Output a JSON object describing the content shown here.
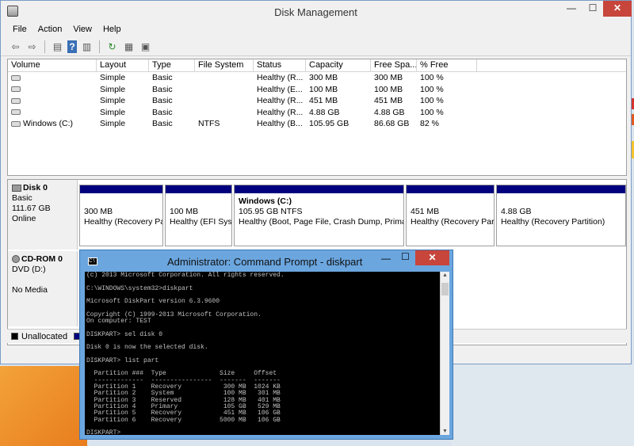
{
  "window": {
    "title": "Disk Management"
  },
  "menu": [
    "File",
    "Action",
    "View",
    "Help"
  ],
  "toolbar_icons": [
    "back-icon",
    "forward-icon",
    "properties-icon",
    "help-icon",
    "console-tree-icon",
    "refresh-icon",
    "rescan-icon",
    "settings-icon"
  ],
  "volumes": {
    "headers": [
      "Volume",
      "Layout",
      "Type",
      "File System",
      "Status",
      "Capacity",
      "Free Spa...",
      "% Free"
    ],
    "rows": [
      [
        "",
        "Simple",
        "Basic",
        "",
        "Healthy (R...",
        "300 MB",
        "300 MB",
        "100 %"
      ],
      [
        "",
        "Simple",
        "Basic",
        "",
        "Healthy (E...",
        "100 MB",
        "100 MB",
        "100 %"
      ],
      [
        "",
        "Simple",
        "Basic",
        "",
        "Healthy (R...",
        "451 MB",
        "451 MB",
        "100 %"
      ],
      [
        "",
        "Simple",
        "Basic",
        "",
        "Healthy (R...",
        "4.88 GB",
        "4.88 GB",
        "100 %"
      ],
      [
        "Windows (C:)",
        "Simple",
        "Basic",
        "NTFS",
        "Healthy (B...",
        "105.95 GB",
        "86.68 GB",
        "82 %"
      ]
    ]
  },
  "disk0": {
    "name": "Disk 0",
    "type": "Basic",
    "size": "111.67 GB",
    "status": "Online",
    "partitions": [
      {
        "title": "",
        "l1": "300 MB",
        "l2": "Healthy (Recovery Pa"
      },
      {
        "title": "",
        "l1": "100 MB",
        "l2": "Healthy (EFI Syst"
      },
      {
        "title": "Windows  (C:)",
        "l1": "105.95 GB NTFS",
        "l2": "Healthy (Boot, Page File, Crash Dump, Primar"
      },
      {
        "title": "",
        "l1": "451 MB",
        "l2": "Healthy (Recovery Par"
      },
      {
        "title": "",
        "l1": "4.88 GB",
        "l2": "Healthy (Recovery Partition)"
      }
    ]
  },
  "cdrom": {
    "name": "CD-ROM 0",
    "type": "DVD (D:)",
    "status": "No Media"
  },
  "legend": {
    "unallocated": "Unallocated",
    "unallocated_color": "#000000",
    "primary_color": "#00007f"
  },
  "cmd": {
    "title": "Administrator: Command Prompt - diskpart",
    "lines": [
      "(c) 2013 Microsoft Corporation. All rights reserved.",
      "",
      "C:\\WINDOWS\\system32>diskpart",
      "",
      "Microsoft DiskPart version 6.3.9600",
      "",
      "Copyright (C) 1999-2013 Microsoft Corporation.",
      "On computer: TEST",
      "",
      "DISKPART> sel disk 0",
      "",
      "Disk 0 is now the selected disk.",
      "",
      "DISKPART> list part",
      "",
      "  Partition ###  Type              Size     Offset",
      "  -------------  ----------------  -------  -------",
      "  Partition 1    Recovery           300 MB  1024 KB",
      "  Partition 2    System             100 MB   301 MB",
      "  Partition 3    Reserved           128 MB   401 MB",
      "  Partition 4    Primary            105 GB   529 MB",
      "  Partition 5    Recovery           451 MB   106 GB",
      "  Partition 6    Recovery          5000 MB   106 GB",
      "",
      "DISKPART> "
    ]
  }
}
